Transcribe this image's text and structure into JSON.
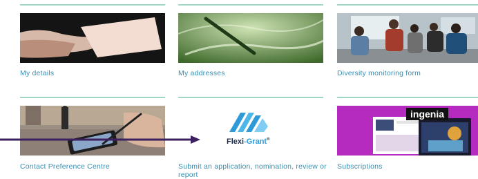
{
  "cards": [
    {
      "label": "My details",
      "image_alt": "Hand holding a blank business card"
    },
    {
      "label": "My addresses",
      "image_alt": "Pen resting on a green-tinted document"
    },
    {
      "label": "Diversity monitoring form",
      "image_alt": "Group of students in a classroom"
    },
    {
      "label": "Contact Preference Centre",
      "image_alt": "Hand using a stylus on a phone on a busy street"
    },
    {
      "label": "Submit an application, nomination, review or report",
      "image_alt": "Flexi-Grant logo",
      "logo_text_a": "Flexi",
      "logo_text_b": "-Grant",
      "logo_mark": "®"
    },
    {
      "label": "Subscriptions",
      "image_alt": "Ingenia magazine covers",
      "magazine_title": "ingenia"
    }
  ],
  "colors": {
    "accent_rule": "#9fd6c4",
    "link": "#3a8fb0",
    "arrow": "#3b1f5e",
    "flexi_blue": "#2e9bd8",
    "ingenia_magenta": "#b52bbf"
  }
}
